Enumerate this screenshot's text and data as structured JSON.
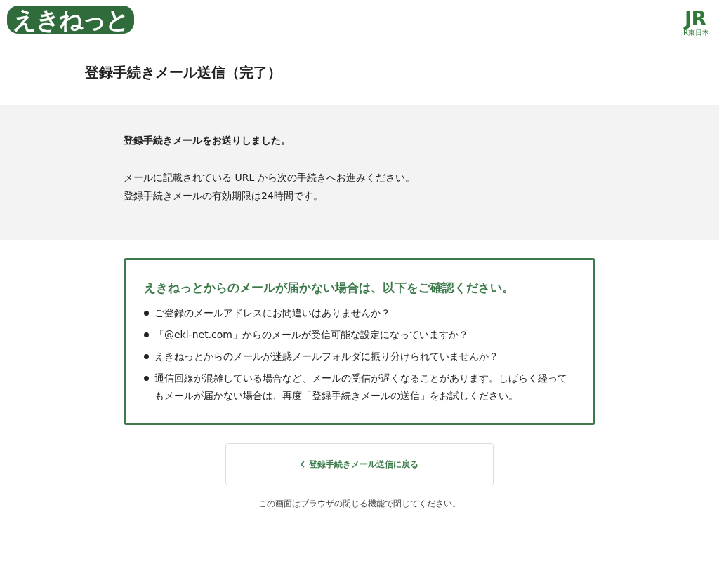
{
  "header": {
    "logo": "えきねっと",
    "brand_mark": "JR",
    "brand_name": "JR東日本"
  },
  "title": "登録手続きメール送信（完了）",
  "notice": {
    "heading": "登録手続きメールをお送りしました。",
    "lines": [
      "メールに記載されている URL から次の手続きへお進みください。",
      "登録手続きメールの有効期限は24時間です。"
    ]
  },
  "help_box": {
    "heading": "えきねっとからのメールが届かない場合は、以下をご確認ください。",
    "items": [
      "ご登録のメールアドレスにお間違いはありませんか？",
      "「@eki-net.com」からのメールが受信可能な設定になっていますか？",
      "えきねっとからのメールが迷惑メールフォルダに振り分けられていませんか？",
      "通信回線が混雑している場合など、メールの受信が遅くなることがあります。しばらく経ってもメールが届かない場合は、再度「登録手続きメールの送信」をお試しください。"
    ]
  },
  "back_button": {
    "label": "登録手続きメール送信に戻る"
  },
  "footer_note": "この画面はブラウザの閉じる機能で閉じてください。"
}
